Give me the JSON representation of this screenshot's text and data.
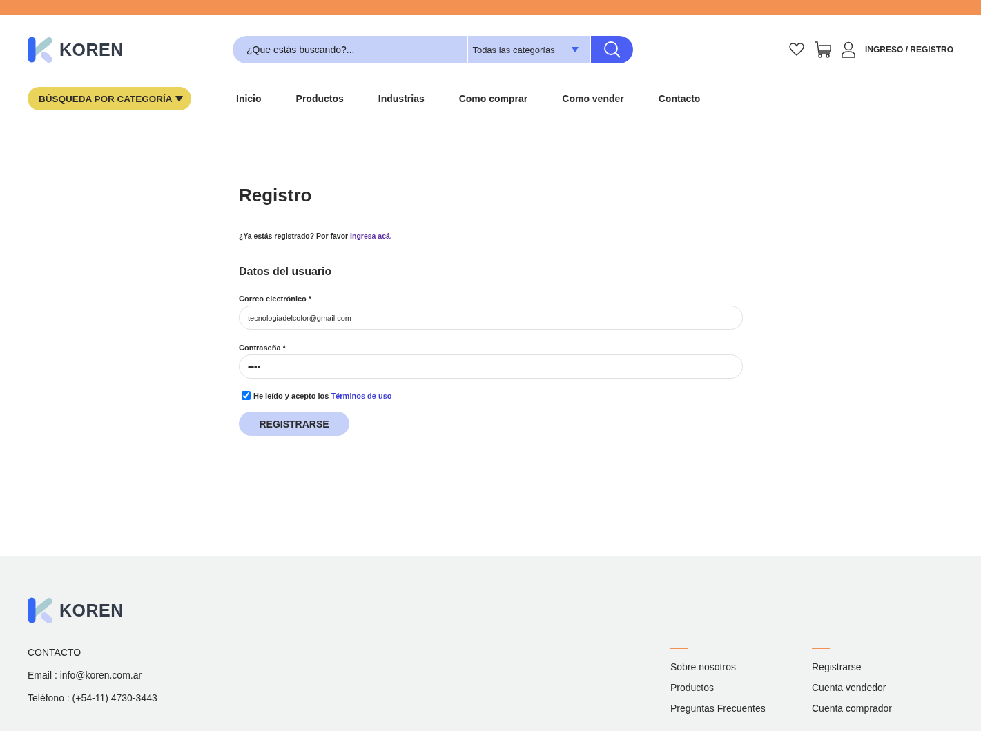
{
  "header": {
    "logo": "KOREN",
    "search": {
      "placeholder": "¿Que estás buscando?...",
      "category": "Todas las categorías"
    },
    "account": "INGRESO / REGISTRO"
  },
  "nav": {
    "category_button": "BÚSQUEDA POR CATEGORÍA",
    "items": [
      {
        "label": "Inicio",
        "selected": false
      },
      {
        "label": "Productos",
        "selected": false
      },
      {
        "label": "Industrias",
        "selected": false
      },
      {
        "label": "Como comprar",
        "selected": false
      },
      {
        "label": "Como vender",
        "selected": false
      },
      {
        "label": "Contacto",
        "selected": false
      }
    ]
  },
  "form": {
    "title": "Registro",
    "login_prompt": "¿Ya estás registrado? Por favor",
    "login_link": "Ingresa acá.",
    "section": "Datos del usuario",
    "fields": [
      {
        "label": "Correo electrónico *",
        "value": "tecnologiadelcolor@gmail.com"
      },
      {
        "label": "Contraseña *",
        "value": "••••"
      }
    ],
    "terms": {
      "checked": true,
      "text": "He leído y acepto los",
      "link": "Términos de uso"
    },
    "submit": "REGISTRARSE"
  },
  "footer": {
    "logo": "KOREN",
    "contact": [
      "CONTACTO",
      "Email : info@koren.com.ar",
      "Teléfono : (+54-11) 4730-3443"
    ],
    "columns": [
      [
        "Sobre nosotros",
        "Productos",
        "Preguntas Frecuentes"
      ],
      [
        "Registrarse",
        "Cuenta vendedor",
        "Cuenta comprador"
      ]
    ]
  }
}
